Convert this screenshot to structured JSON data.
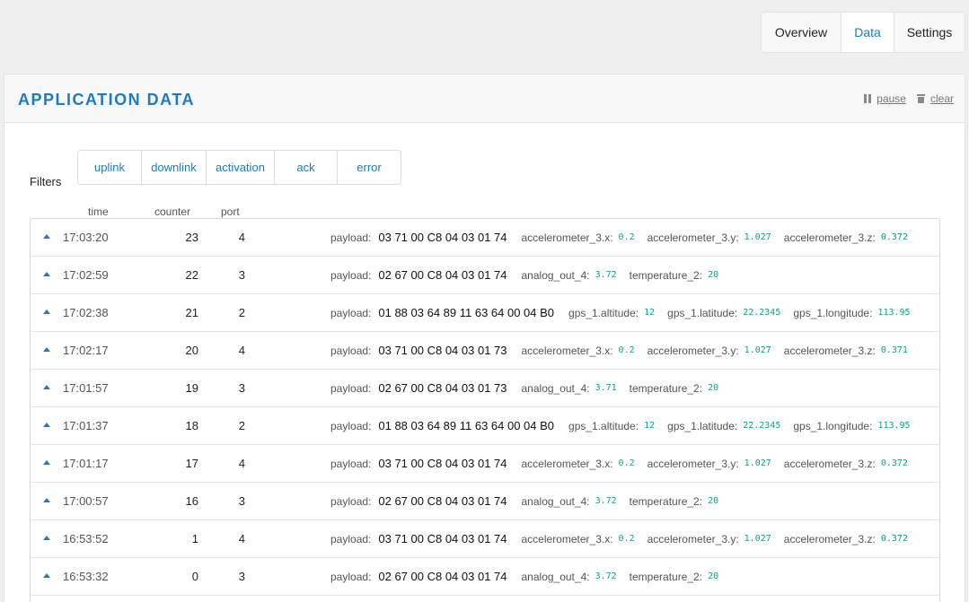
{
  "tabs": [
    {
      "label": "Overview"
    },
    {
      "label": "Data"
    },
    {
      "label": "Settings"
    }
  ],
  "panel": {
    "title": "APPLICATION DATA",
    "pause_label": "pause",
    "clear_label": "clear"
  },
  "filters": {
    "label": "Filters",
    "items": [
      "uplink",
      "downlink",
      "activation",
      "ack",
      "error"
    ]
  },
  "columns": {
    "time": "time",
    "counter": "counter",
    "port": "port"
  },
  "payload_label": "payload:",
  "rows": [
    {
      "time": "17:03:20",
      "counter": "23",
      "port": "4",
      "payload": "03 71 00 C8 04 03 01 74",
      "fields": [
        {
          "name": "accelerometer_3.x:",
          "value": "0.2"
        },
        {
          "name": "accelerometer_3.y:",
          "value": "1.027"
        },
        {
          "name": "accelerometer_3.z:",
          "value": "0.372"
        }
      ]
    },
    {
      "time": "17:02:59",
      "counter": "22",
      "port": "3",
      "payload": "02 67 00 C8 04 03 01 74",
      "fields": [
        {
          "name": "analog_out_4:",
          "value": "3.72"
        },
        {
          "name": "temperature_2:",
          "value": "20"
        }
      ]
    },
    {
      "time": "17:02:38",
      "counter": "21",
      "port": "2",
      "payload": "01 88 03 64 89 11 63 64 00 04 B0",
      "fields": [
        {
          "name": "gps_1.altitude:",
          "value": "12"
        },
        {
          "name": "gps_1.latitude:",
          "value": "22.2345"
        },
        {
          "name": "gps_1.longitude:",
          "value": "113.95"
        }
      ]
    },
    {
      "time": "17:02:17",
      "counter": "20",
      "port": "4",
      "payload": "03 71 00 C8 04 03 01 73",
      "fields": [
        {
          "name": "accelerometer_3.x:",
          "value": "0.2"
        },
        {
          "name": "accelerometer_3.y:",
          "value": "1.027"
        },
        {
          "name": "accelerometer_3.z:",
          "value": "0.371"
        }
      ]
    },
    {
      "time": "17:01:57",
      "counter": "19",
      "port": "3",
      "payload": "02 67 00 C8 04 03 01 73",
      "fields": [
        {
          "name": "analog_out_4:",
          "value": "3.71"
        },
        {
          "name": "temperature_2:",
          "value": "20"
        }
      ]
    },
    {
      "time": "17:01:37",
      "counter": "18",
      "port": "2",
      "payload": "01 88 03 64 89 11 63 64 00 04 B0",
      "fields": [
        {
          "name": "gps_1.altitude:",
          "value": "12"
        },
        {
          "name": "gps_1.latitude:",
          "value": "22.2345"
        },
        {
          "name": "gps_1.longitude:",
          "value": "113.95"
        }
      ]
    },
    {
      "time": "17:01:17",
      "counter": "17",
      "port": "4",
      "payload": "03 71 00 C8 04 03 01 74",
      "fields": [
        {
          "name": "accelerometer_3.x:",
          "value": "0.2"
        },
        {
          "name": "accelerometer_3.y:",
          "value": "1.027"
        },
        {
          "name": "accelerometer_3.z:",
          "value": "0.372"
        }
      ]
    },
    {
      "time": "17:00:57",
      "counter": "16",
      "port": "3",
      "payload": "02 67 00 C8 04 03 01 74",
      "fields": [
        {
          "name": "analog_out_4:",
          "value": "3.72"
        },
        {
          "name": "temperature_2:",
          "value": "20"
        }
      ]
    },
    {
      "time": "16:53:52",
      "counter": "1",
      "port": "4",
      "payload": "03 71 00 C8 04 03 01 74",
      "fields": [
        {
          "name": "accelerometer_3.x:",
          "value": "0.2"
        },
        {
          "name": "accelerometer_3.y:",
          "value": "1.027"
        },
        {
          "name": "accelerometer_3.z:",
          "value": "0.372"
        }
      ]
    },
    {
      "time": "16:53:32",
      "counter": "0",
      "port": "3",
      "payload": "02 67 00 C8 04 03 01 74",
      "fields": [
        {
          "name": "analog_out_4:",
          "value": "3.72"
        },
        {
          "name": "temperature_2:",
          "value": "20"
        }
      ]
    }
  ],
  "colors": {
    "accent": "#1f7bc1",
    "value": "#16a085",
    "background": "#efefef"
  }
}
